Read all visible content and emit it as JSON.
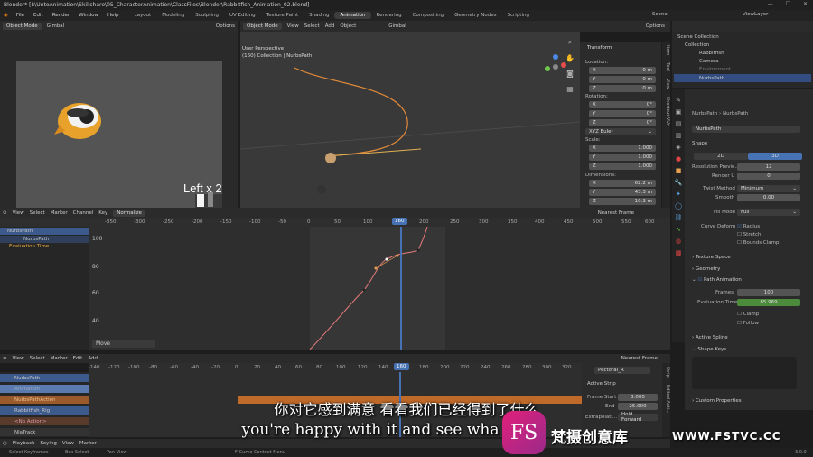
{
  "title": "Blender* [I:\\UntoAnimation\\Skillshare\\05_CharacterAnimation\\ClassFiles\\Blender\\Rabbitfish_Animation_02.blend]",
  "menus": [
    "File",
    "Edit",
    "Render",
    "Window",
    "Help"
  ],
  "workspaces": [
    "Layout",
    "Modeling",
    "Sculpting",
    "UV Editing",
    "Texture Paint",
    "Shading",
    "Animation",
    "Rendering",
    "Compositing",
    "Geometry Nodes",
    "Scripting"
  ],
  "active_workspace": "Animation",
  "scene": "Scene",
  "view_layer": "ViewLayer",
  "left_header": {
    "mode": "Object Mode",
    "orient": "Gimbal",
    "options": "Options"
  },
  "camera_text": "Left x 2",
  "viewport": {
    "mode": "Object Mode",
    "menus": [
      "View",
      "Select",
      "Add",
      "Object"
    ],
    "orient": "Gimbal",
    "options": "Options",
    "line1": "User Perspective",
    "line2": "(160) Collection | NurbsPath"
  },
  "transform": {
    "title": "Transform",
    "location_label": "Location:",
    "location": [
      {
        "k": "X",
        "v": "0 m"
      },
      {
        "k": "Y",
        "v": "0 m"
      },
      {
        "k": "Z",
        "v": "0 m"
      }
    ],
    "rotation_label": "Rotation:",
    "rotation": [
      {
        "k": "X",
        "v": "0°"
      },
      {
        "k": "Y",
        "v": "0°"
      },
      {
        "k": "Z",
        "v": "0°"
      }
    ],
    "rot_mode": "XYZ Euler",
    "scale_label": "Scale:",
    "scale": [
      {
        "k": "X",
        "v": "1.000"
      },
      {
        "k": "Y",
        "v": "1.000"
      },
      {
        "k": "Z",
        "v": "1.000"
      }
    ],
    "dimensions_label": "Dimensions:",
    "dimensions": [
      {
        "k": "X",
        "v": "62.2 m"
      },
      {
        "k": "Y",
        "v": "43.3 m"
      },
      {
        "k": "Z",
        "v": "10.3 m"
      }
    ]
  },
  "side_tabs": [
    "Item",
    "Tool",
    "View",
    "Shortcut VUr"
  ],
  "outliner": {
    "root": "Scene Collection",
    "items": [
      "Collection",
      "Rabbitfish",
      "Camera",
      "Environment",
      "NurbsPath"
    ]
  },
  "props": {
    "breadcrumb_a": "NurbsPath",
    "breadcrumb_b": "NurbsPath",
    "datablock": "NurbsPath",
    "shape": "Shape",
    "dim2d": "2D",
    "dim3d": "3D",
    "rows": [
      {
        "k": "Resolution Previe...",
        "v": "12"
      },
      {
        "k": "Render U",
        "v": "0"
      },
      {
        "k": "Twist Method",
        "v": "Minimum"
      },
      {
        "k": "Smooth",
        "v": "0.00"
      },
      {
        "k": "Fill Mode",
        "v": "Full"
      }
    ],
    "curve_deform": "Curve Deform",
    "radius": "Radius",
    "stretch": "Stretch",
    "bounds_clamp": "Bounds Clamp",
    "texture_space": "Texture Space",
    "geometry": "Geometry",
    "path_animation": "Path Animation",
    "frames_label": "Frames",
    "frames": "100",
    "eval_label": "Evaluation Time",
    "eval_time": "85.969",
    "clamp": "Clamp",
    "follow": "Follow",
    "active_spline": "Active Spline",
    "shape_keys": "Shape Keys",
    "custom_props": "Custom Properties"
  },
  "graph": {
    "menus": [
      "View",
      "Select",
      "Marker",
      "Channel",
      "Key"
    ],
    "normalize": "Normalize",
    "interp": "Nearest Frame",
    "ruler": [
      "-350",
      "-300",
      "-250",
      "-200",
      "-150",
      "-100",
      "-50",
      "0",
      "50",
      "100",
      "150",
      "200",
      "250",
      "300",
      "350",
      "400",
      "450",
      "500",
      "550",
      "600"
    ],
    "current_frame": "160",
    "yticks": [
      "100",
      "80",
      "60",
      "40"
    ],
    "channels": [
      "NurbsPath",
      "NurbsPath",
      "Evaluation Time"
    ],
    "status": "Move"
  },
  "nla": {
    "menus": [
      "View",
      "Select",
      "Marker",
      "Edit",
      "Add"
    ],
    "interp": "Nearest Frame",
    "ruler": [
      "-140",
      "-120",
      "-100",
      "-80",
      "-60",
      "-40",
      "-20",
      "0",
      "20",
      "40",
      "60",
      "80",
      "100",
      "120",
      "140",
      "160",
      "180",
      "200",
      "220",
      "240",
      "260",
      "280",
      "300",
      "320"
    ],
    "current_frame": "160",
    "tracks": [
      "NurbsPath",
      "Animation",
      "NurbsPathAction",
      "Rabbitfish_Rig",
      "<No Action>",
      "NlaTrack"
    ],
    "strip_name": "Pectoral_R",
    "active_strip": "Active Strip",
    "frame_start_label": "Frame Start",
    "frame_start": "3.000",
    "end_label": "End",
    "end": "25.000",
    "extrap_label": "Extrapolati...",
    "extrap": "Hold Forward",
    "tabs": [
      "Strip",
      "Edited Acti..."
    ]
  },
  "timeline": {
    "menus": [
      "Playback",
      "Keying",
      "View",
      "Marker"
    ]
  },
  "statusbar": [
    "Select Keyframes",
    "Box Select",
    "Pan View",
    "F-Curve Context Menu"
  ],
  "version": "3.0.0",
  "subtitle_cn": "你对它感到满意 看看我们已经得到了什么",
  "subtitle_en": "you're happy with it and see wha",
  "watermark_logo": "FS",
  "watermark_cn": "梵摄创意库",
  "watermark_url": "WWW.FSTVC.CC"
}
